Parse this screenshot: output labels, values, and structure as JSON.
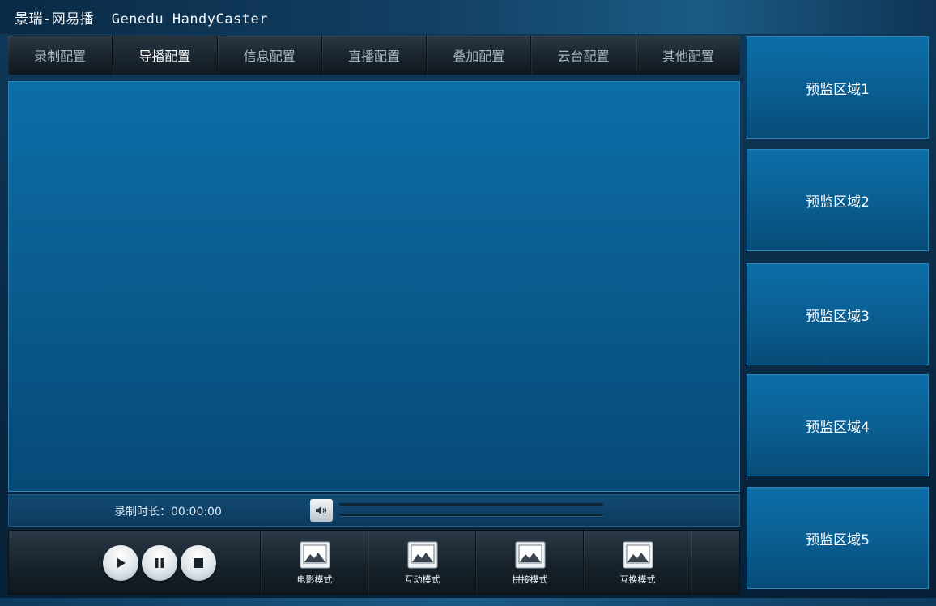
{
  "app": {
    "title": "景瑞-网易播  Genedu HandyCaster"
  },
  "tabs": [
    {
      "label": "录制配置",
      "active": false
    },
    {
      "label": "导播配置",
      "active": true
    },
    {
      "label": "信息配置",
      "active": false
    },
    {
      "label": "直播配置",
      "active": false
    },
    {
      "label": "叠加配置",
      "active": false
    },
    {
      "label": "云台配置",
      "active": false
    },
    {
      "label": "其他配置",
      "active": false
    }
  ],
  "status": {
    "record_duration": "录制时长：00:00:00"
  },
  "playback": {
    "icons": [
      "play-icon",
      "pause-icon",
      "stop-icon"
    ]
  },
  "modes": [
    {
      "label": "电影模式",
      "icon": "image-icon"
    },
    {
      "label": "互动模式",
      "icon": "image-icon"
    },
    {
      "label": "拼接模式",
      "icon": "image-icon"
    },
    {
      "label": "互换模式",
      "icon": "image-icon"
    }
  ],
  "preview_panels": [
    {
      "label": "预监区域1"
    },
    {
      "label": "预监区域2"
    },
    {
      "label": "预监区域3"
    },
    {
      "label": "预监区域4"
    },
    {
      "label": "预监区域5"
    }
  ],
  "colors": {
    "accent": "#0a5d91",
    "panel_border": "#2d84b8",
    "toolbar": "#1a252e"
  }
}
